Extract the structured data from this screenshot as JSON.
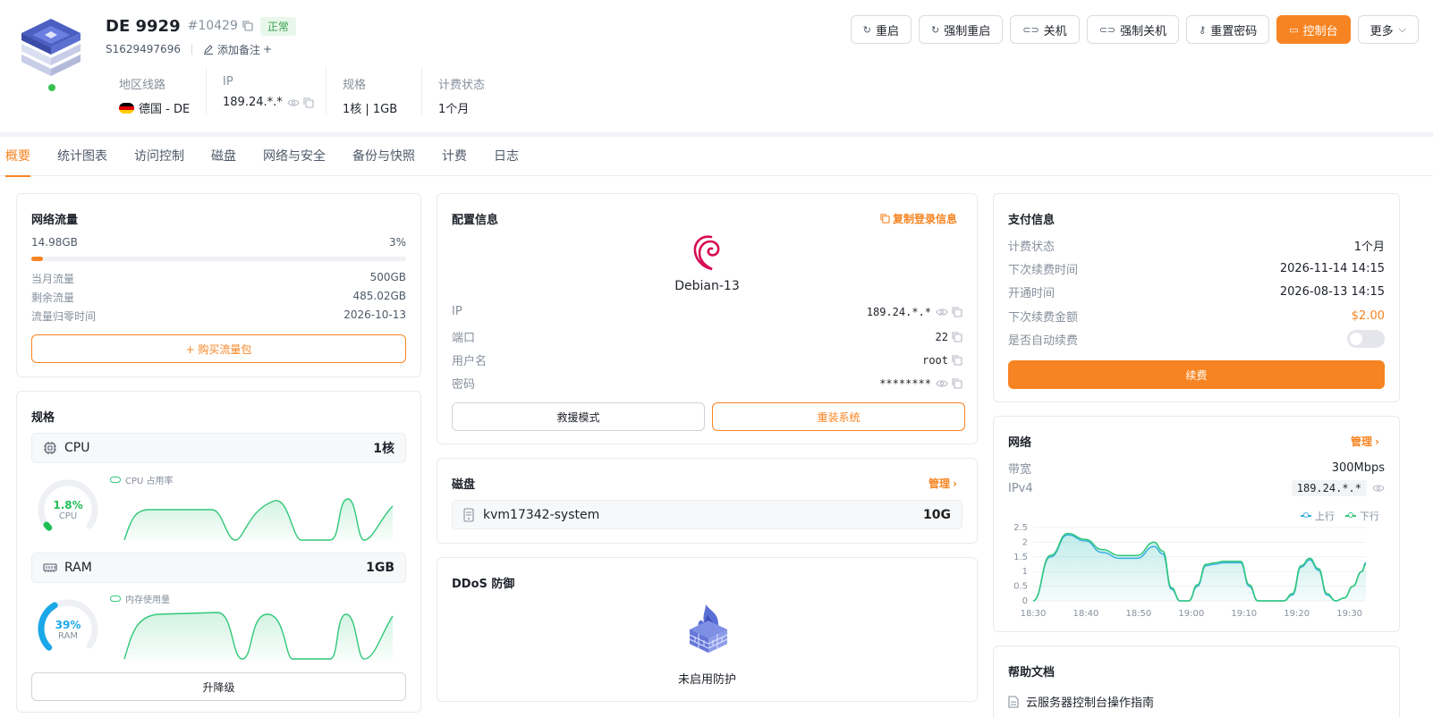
{
  "server": {
    "name": "DE 9929",
    "id": "#10429",
    "status": "正常",
    "code": "S1629497696",
    "add_note": "添加备注",
    "add_note_plus": "+"
  },
  "info": {
    "region_label": "地区线路",
    "region_value": "德国 - DE",
    "ip_label": "IP",
    "ip_value": "189.24.*.*",
    "spec_label": "规格",
    "spec_value": "1核 | 1GB",
    "billing_label": "计费状态",
    "billing_value": "1个月"
  },
  "actions": {
    "restart": "重启",
    "force_restart": "强制重启",
    "shutdown": "关机",
    "force_shutdown": "强制关机",
    "reset_password": "重置密码",
    "console": "控制台",
    "more": "更多"
  },
  "tabs": [
    "概要",
    "统计图表",
    "访问控制",
    "磁盘",
    "网络与安全",
    "备份与快照",
    "计费",
    "日志"
  ],
  "traffic": {
    "title": "网络流量",
    "used": "14.98GB",
    "percent_label": "3%",
    "percent": 0.03,
    "monthly_label": "当月流量",
    "monthly_value": "500GB",
    "remaining_label": "剩余流量",
    "remaining_value": "485.02GB",
    "reset_label": "流量归零时间",
    "reset_value": "2026-10-13",
    "buy_button": "+ 购买流量包"
  },
  "spec": {
    "title": "规格",
    "cpu_label": "CPU",
    "cpu_value": "1核",
    "cpu_usage": "1.8%",
    "cpu_usage_fraction": 0.018,
    "cpu_gauge_label": "CPU",
    "cpu_legend": "CPU 占用率",
    "ram_label": "RAM",
    "ram_value": "1GB",
    "ram_usage": "39%",
    "ram_usage_fraction": 0.39,
    "ram_gauge_label": "RAM",
    "ram_legend": "内存使用量",
    "upgrade_button": "升降级"
  },
  "config": {
    "title": "配置信息",
    "copy_login": "复制登录信息",
    "os": "Debian-13",
    "ip_label": "IP",
    "ip_value": "189.24.*.*",
    "port_label": "端口",
    "port_value": "22",
    "user_label": "用户名",
    "user_value": "root",
    "password_label": "密码",
    "password_value": "********",
    "rescue_button": "救援模式",
    "reinstall_button": "重装系统"
  },
  "disk": {
    "title": "磁盘",
    "manage": "管理",
    "name": "kvm17342-system",
    "size": "10G"
  },
  "ddos": {
    "title": "DDoS 防御",
    "status": "未启用防护"
  },
  "payment": {
    "title": "支付信息",
    "billing_label": "计费状态",
    "billing_value": "1个月",
    "next_renew_label": "下次续费时间",
    "next_renew_value": "2026-11-14 14:15",
    "open_label": "开通时间",
    "open_value": "2026-08-13 14:15",
    "next_amount_label": "下次续费金额",
    "next_amount_value": "$2.00",
    "auto_renew_label": "是否自动续费",
    "auto_renew": false,
    "renew_button": "续费"
  },
  "network": {
    "title": "网络",
    "manage": "管理",
    "bandwidth_label": "带宽",
    "bandwidth_value": "300Mbps",
    "ipv4_label": "IPv4",
    "ipv4_value": "189.24.*.*"
  },
  "help": {
    "title": "帮助文档",
    "first_doc": "云服务器控制台操作指南"
  },
  "colors": {
    "accent": "#f78422",
    "status_green": "#39c151",
    "upload_line": "#3ab0e0",
    "download_line": "#31c87a"
  },
  "chart_data": {
    "type": "line",
    "x": [
      "18:30",
      "18:40",
      "18:50",
      "19:00",
      "19:10",
      "19:20",
      "19:30"
    ],
    "yticks": [
      "0",
      "0.5",
      "1",
      "1.5",
      "2",
      "2.5"
    ],
    "ylim": [
      0,
      2.5
    ],
    "legend_position": "top-right",
    "series": [
      {
        "name": "上行",
        "color": "#3ab0e0",
        "points": [
          [
            0,
            0
          ],
          [
            2,
            1.5
          ],
          [
            4,
            2.25
          ],
          [
            6,
            2.05
          ],
          [
            8,
            1.65
          ],
          [
            10,
            1.45
          ],
          [
            12,
            1.45
          ],
          [
            14,
            1.85
          ],
          [
            15,
            1.6
          ],
          [
            16,
            0.4
          ],
          [
            17,
            0
          ],
          [
            18,
            0
          ],
          [
            19,
            0.5
          ],
          [
            20,
            1.2
          ],
          [
            21,
            1.25
          ],
          [
            22,
            1.3
          ],
          [
            24,
            1.3
          ],
          [
            25,
            0.5
          ],
          [
            26,
            0
          ],
          [
            27,
            0
          ],
          [
            29,
            0
          ],
          [
            30,
            0.2
          ],
          [
            31,
            1.15
          ],
          [
            32,
            1.4
          ],
          [
            33,
            1.05
          ],
          [
            34,
            0.2
          ],
          [
            35,
            0
          ],
          [
            36,
            0.1
          ],
          [
            37,
            0.5
          ],
          [
            38,
            1.0
          ],
          [
            38.5,
            1.3
          ]
        ]
      },
      {
        "name": "下行",
        "color": "#31c87a",
        "points": [
          [
            0,
            0
          ],
          [
            2,
            1.55
          ],
          [
            4,
            2.3
          ],
          [
            6,
            2.1
          ],
          [
            8,
            1.75
          ],
          [
            10,
            1.55
          ],
          [
            12,
            1.55
          ],
          [
            14,
            2.0
          ],
          [
            15,
            1.7
          ],
          [
            16,
            0.45
          ],
          [
            17,
            0
          ],
          [
            18,
            0
          ],
          [
            19,
            0.55
          ],
          [
            20,
            1.25
          ],
          [
            21,
            1.3
          ],
          [
            22,
            1.35
          ],
          [
            24,
            1.35
          ],
          [
            25,
            0.55
          ],
          [
            26,
            0
          ],
          [
            27,
            0
          ],
          [
            29,
            0
          ],
          [
            30,
            0.25
          ],
          [
            31,
            1.2
          ],
          [
            32,
            1.45
          ],
          [
            33,
            1.1
          ],
          [
            34,
            0.25
          ],
          [
            35,
            0
          ],
          [
            36,
            0.1
          ],
          [
            37,
            0.5
          ],
          [
            38,
            1.0
          ],
          [
            38.5,
            1.25
          ]
        ]
      }
    ],
    "x_index_span": [
      0,
      38.5
    ],
    "x_label_indices": [
      0,
      6.1,
      12.2,
      18.3,
      24.4,
      30.5,
      36.6
    ]
  }
}
